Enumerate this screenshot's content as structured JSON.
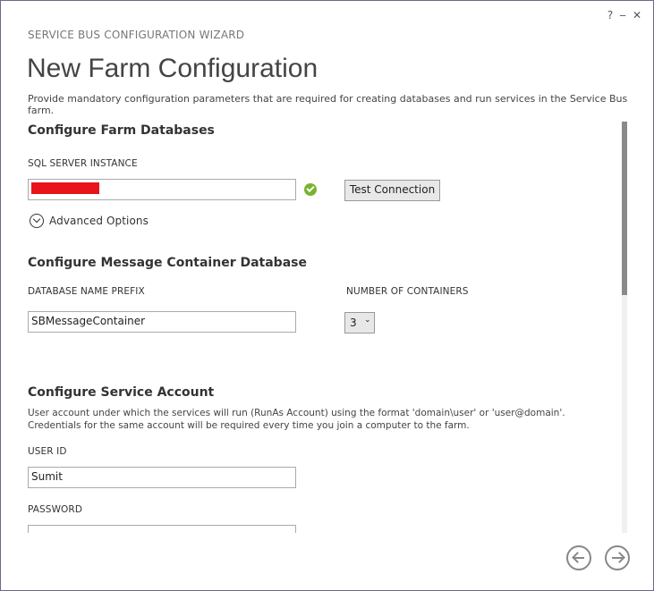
{
  "window": {
    "controls": {
      "help": "?",
      "minimize": "‒",
      "close": "✕"
    }
  },
  "wizard_title": "SERVICE BUS CONFIGURATION WIZARD",
  "page_title": "New Farm Configuration",
  "page_description": "Provide mandatory configuration parameters that are required for creating databases and run services in the Service Bus farm.",
  "farm_databases": {
    "heading": "Configure Farm Databases",
    "sql_label": "SQL SERVER INSTANCE",
    "sql_value": "",
    "test_connection_label": "Test Connection",
    "advanced_options_label": "Advanced Options",
    "status_color": "#7ab32e"
  },
  "message_container": {
    "heading": "Configure Message Container Database",
    "prefix_label": "DATABASE NAME PREFIX",
    "prefix_value": "SBMessageContainer",
    "containers_label": "NUMBER OF CONTAINERS",
    "containers_value": "3"
  },
  "service_account": {
    "heading": "Configure Service Account",
    "description": "User account under which the services will run (RunAs Account) using the format 'domain\\user' or 'user@domain'. Credentials for the same account will be required every time you join a computer to the farm.",
    "user_id_label": "USER ID",
    "user_id_value": "Sumit",
    "password_label": "PASSWORD",
    "password_value": ""
  },
  "navigation": {
    "back_icon": "arrow-left-circle",
    "next_icon": "arrow-right-circle"
  }
}
